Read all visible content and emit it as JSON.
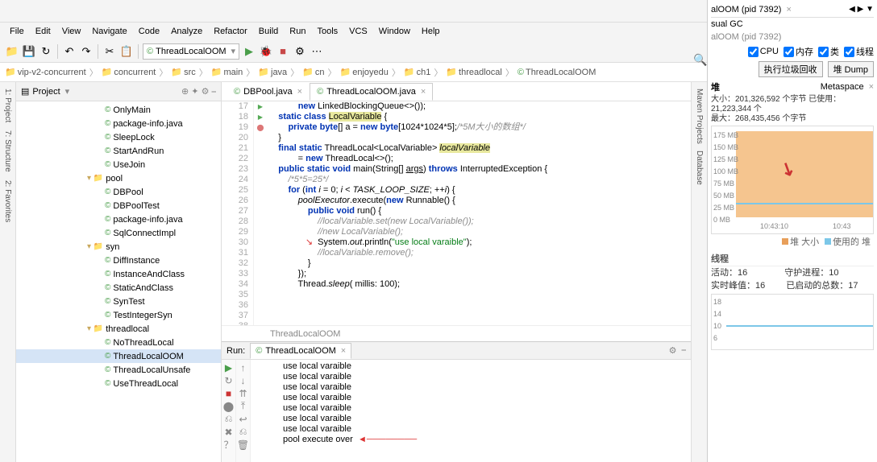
{
  "menubar": [
    "File",
    "Edit",
    "View",
    "Navigate",
    "Code",
    "Analyze",
    "Refactor",
    "Build",
    "Run",
    "Tools",
    "VCS",
    "Window",
    "Help"
  ],
  "run_config_label": "ThreadLocalOOM",
  "breadcrumb": [
    "vip-v2-concurrent",
    "concurrent",
    "src",
    "main",
    "java",
    "cn",
    "enjoyedu",
    "ch1",
    "threadlocal",
    "ThreadLocalOOM"
  ],
  "project_hdr": "Project",
  "tree": [
    {
      "pad": 110,
      "icon": "©",
      "cls": "ico",
      "txt": "OnlyMain"
    },
    {
      "pad": 110,
      "icon": "©",
      "cls": "ico",
      "txt": "package-info.java"
    },
    {
      "pad": 110,
      "icon": "©",
      "cls": "ico",
      "txt": "SleepLock"
    },
    {
      "pad": 110,
      "icon": "©",
      "cls": "ico",
      "txt": "StartAndRun"
    },
    {
      "pad": 110,
      "icon": "©",
      "cls": "ico",
      "txt": "UseJoin"
    },
    {
      "pad": 88,
      "icon": "▾ 📁",
      "cls": "ico fold2",
      "txt": "pool"
    },
    {
      "pad": 110,
      "icon": "©",
      "cls": "ico",
      "txt": "DBPool"
    },
    {
      "pad": 110,
      "icon": "©",
      "cls": "ico",
      "txt": "DBPoolTest"
    },
    {
      "pad": 110,
      "icon": "©",
      "cls": "ico",
      "txt": "package-info.java"
    },
    {
      "pad": 110,
      "icon": "©",
      "cls": "ico",
      "txt": "SqlConnectImpl"
    },
    {
      "pad": 88,
      "icon": "▾ 📁",
      "cls": "ico fold2",
      "txt": "syn"
    },
    {
      "pad": 110,
      "icon": "©",
      "cls": "ico",
      "txt": "DiffInstance"
    },
    {
      "pad": 110,
      "icon": "©",
      "cls": "ico",
      "txt": "InstanceAndClass"
    },
    {
      "pad": 110,
      "icon": "©",
      "cls": "ico",
      "txt": "StaticAndClass"
    },
    {
      "pad": 110,
      "icon": "©",
      "cls": "ico",
      "txt": "SynTest"
    },
    {
      "pad": 110,
      "icon": "©",
      "cls": "ico",
      "txt": "TestIntegerSyn"
    },
    {
      "pad": 88,
      "icon": "▾ 📁",
      "cls": "ico fold2",
      "txt": "threadlocal"
    },
    {
      "pad": 110,
      "icon": "©",
      "cls": "ico",
      "txt": "NoThreadLocal"
    },
    {
      "pad": 110,
      "icon": "©",
      "cls": "ico",
      "txt": "ThreadLocalOOM",
      "sel": true
    },
    {
      "pad": 110,
      "icon": "©",
      "cls": "ico",
      "txt": "ThreadLocalUnsafe"
    },
    {
      "pad": 110,
      "icon": "©",
      "cls": "ico",
      "txt": "UseThreadLocal"
    }
  ],
  "editor_tabs": [
    {
      "label": "DBPool.java",
      "active": false
    },
    {
      "label": "ThreadLocalOOM.java",
      "active": true
    }
  ],
  "line_start": 17,
  "line_end": 38,
  "editor_status": "ThreadLocalOOM",
  "code_lines": [
    {
      "n": 17,
      "html": "            <span class='kw'>new</span> LinkedBlockingQueue&lt;&gt;());"
    },
    {
      "n": 18,
      "html": ""
    },
    {
      "n": 19,
      "html": "    <span class='kw'>static</span> <span class='kw'>class</span> <span class='hl'>LocalVariable</span> {"
    },
    {
      "n": 20,
      "html": "        <span class='kw'>private</span> <span class='kw'>byte</span>[] a = <span class='kw'>new</span> <span class='kw'>byte</span>[1024*1024*5];<span class='cm'>/*5M大小的数组*/</span>"
    },
    {
      "n": 21,
      "html": "    }"
    },
    {
      "n": 22,
      "html": ""
    },
    {
      "n": 23,
      "html": "    <span class='kw'>final</span> <span class='kw'>static</span> ThreadLocal&lt;LocalVariable&gt; <span class='hl'><i>localVariable</i></span>"
    },
    {
      "n": 24,
      "html": "            = <span class='kw'>new</span> ThreadLocal&lt;&gt;();"
    },
    {
      "n": 25,
      "html": "",
      "mark": "▶",
      "bg": "#fffff0"
    },
    {
      "n": 26,
      "html": "    <span class='kw'>public</span> <span class='kw'>static</span> <span class='kw'>void</span> main(String[] <span class='uline'>args</span>) <span class='kw'>throws</span> InterruptedException {",
      "mark": "▶"
    },
    {
      "n": 27,
      "html": "        <span class='cm'>/*5*5=25*/</span>"
    },
    {
      "n": 28,
      "html": "        <span class='kw'>for</span> (<span class='kw'>int</span> <span class='fn'>i</span> = 0; <span class='fn'>i</span> &lt; <span class='fn'>TASK_LOOP_SIZE</span>; ++<span class='fn'>i</span>) {"
    },
    {
      "n": 29,
      "html": "            <span class='fn'>poolExecutor</span>.execute(<span class='kw'>new</span> Runnable() {"
    },
    {
      "n": 30,
      "html": "                <span class='kw'>public</span> <span class='kw'>void</span> run() {",
      "mark": "⬤"
    },
    {
      "n": 31,
      "html": "                    <span class='cm'>//localVariable.set(new LocalVariable());</span>"
    },
    {
      "n": 32,
      "html": "                    <span class='cm'>//new LocalVariable();</span>"
    },
    {
      "n": 33,
      "html": "               <span class='red-arrow'>↘</span>  System.<span class='fn'>out</span>.println(<span class='str'>\"use local varaible\"</span>);"
    },
    {
      "n": 34,
      "html": "                    <span class='cm'>//localVariable.remove();</span>"
    },
    {
      "n": 35,
      "html": "                }"
    },
    {
      "n": 36,
      "html": "            });"
    },
    {
      "n": 37,
      "html": ""
    },
    {
      "n": 38,
      "html": "            Thread.<span class='fn'>sleep</span>( millis: 100);"
    }
  ],
  "run_tab": "ThreadLocalOOM",
  "run_label": "Run:",
  "console_lines": [
    "use local varaible",
    "use local varaible",
    "use local varaible",
    "use local varaible",
    "use local varaible",
    "use local varaible",
    "use local varaible",
    "pool execute over"
  ],
  "console_arrow": "◄────────",
  "left_tabs": [
    "1: Project",
    "7: Structure",
    "2: Favorites"
  ],
  "right_tabs": [
    "Maven Projects",
    "Database"
  ],
  "profiler": {
    "tab_title": "alOOM (pid 7392)",
    "subtitle": "sual GC",
    "process": "alOOM (pid 7392)",
    "chk_cpu": "CPU",
    "chk_mem": "内存",
    "chk_class": "类",
    "chk_thread": "线程",
    "btn_gc": "执行垃圾回收",
    "btn_dump": "堆 Dump",
    "metaspace": "Metaspace",
    "heap_hdr": "堆",
    "size": "大小：201,326,592 个字节  已使用：21,223,344 个",
    "max": "最大：268,435,456 个字节",
    "ylabels": [
      "175 MB",
      "150 MB",
      "125 MB",
      "100 MB",
      "75 MB",
      "50 MB",
      "25 MB",
      "0 MB"
    ],
    "xlabels": [
      "10:43:10",
      "10:43"
    ],
    "legend_a": "堆 大小",
    "legend_b": "使用的 堆",
    "thread_hdr": "线程",
    "active": "活动：16",
    "daemon": "守护进程：10",
    "peak": "实时峰值：16",
    "started": "已启动的总数：17",
    "chart_data": {
      "type": "area",
      "categories": [
        "10:43:10",
        "10:43"
      ],
      "series": [
        {
          "name": "堆 大小",
          "values": [
            180,
            180
          ],
          "color": "#e89f5a"
        },
        {
          "name": "使用的 堆",
          "values": [
            25,
            25
          ],
          "color": "#7cc7e8"
        }
      ],
      "ylim": [
        0,
        200
      ],
      "ylabel": "MB",
      "title": "堆"
    },
    "thread_chart": {
      "type": "line",
      "ylabels": [
        "18",
        "14",
        "10",
        "6"
      ],
      "series": [
        {
          "name": "活动",
          "values": [
            10,
            10,
            10
          ]
        }
      ]
    }
  }
}
